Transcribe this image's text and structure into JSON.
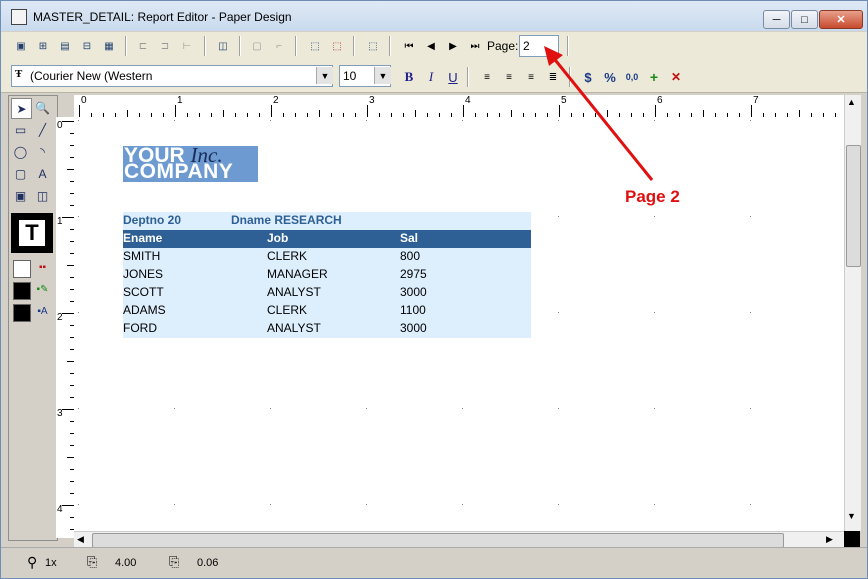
{
  "window": {
    "title": "MASTER_DETAIL: Report Editor - Paper Design",
    "btn_min": "─",
    "btn_max": "□",
    "btn_close": "✕"
  },
  "toolbar": {
    "page_label": "Page:",
    "page_value": "2",
    "font_value": "(Courier New (Western",
    "size_value": "10",
    "bold": "B",
    "italic": "I",
    "underline": "U",
    "currency": "$",
    "percent": "%",
    "decimals": "0,0"
  },
  "ruler": {
    "top_ticks": [
      "0",
      "1",
      "2",
      "3",
      "4",
      "5",
      "6",
      "7"
    ],
    "left_ticks": [
      "0",
      "1",
      "2",
      "3",
      "4"
    ]
  },
  "report": {
    "logo_line1": "YOUR ",
    "logo_inc": "Inc.",
    "logo_line2": "COMPANY",
    "deptno": "Deptno 20",
    "dname": "Dname RESEARCH",
    "columns": [
      "Ename",
      "Job",
      "Sal"
    ],
    "rows": [
      [
        "SMITH",
        "CLERK",
        "800"
      ],
      [
        "JONES",
        "MANAGER",
        "2975"
      ],
      [
        "SCOTT",
        "ANALYST",
        "3000"
      ],
      [
        "ADAMS",
        "CLERK",
        "1100"
      ],
      [
        "FORD",
        "ANALYST",
        "3000"
      ]
    ]
  },
  "annotation": {
    "text": "Page 2",
    "color": "#e01010"
  },
  "status": {
    "zoom": "1x",
    "x_pos": "4.00",
    "y_pos": "0.06"
  },
  "colors": {
    "header_blue": "#2e6096",
    "light_blue": "#ddeefc",
    "logo_blue": "#6d9bd1"
  }
}
